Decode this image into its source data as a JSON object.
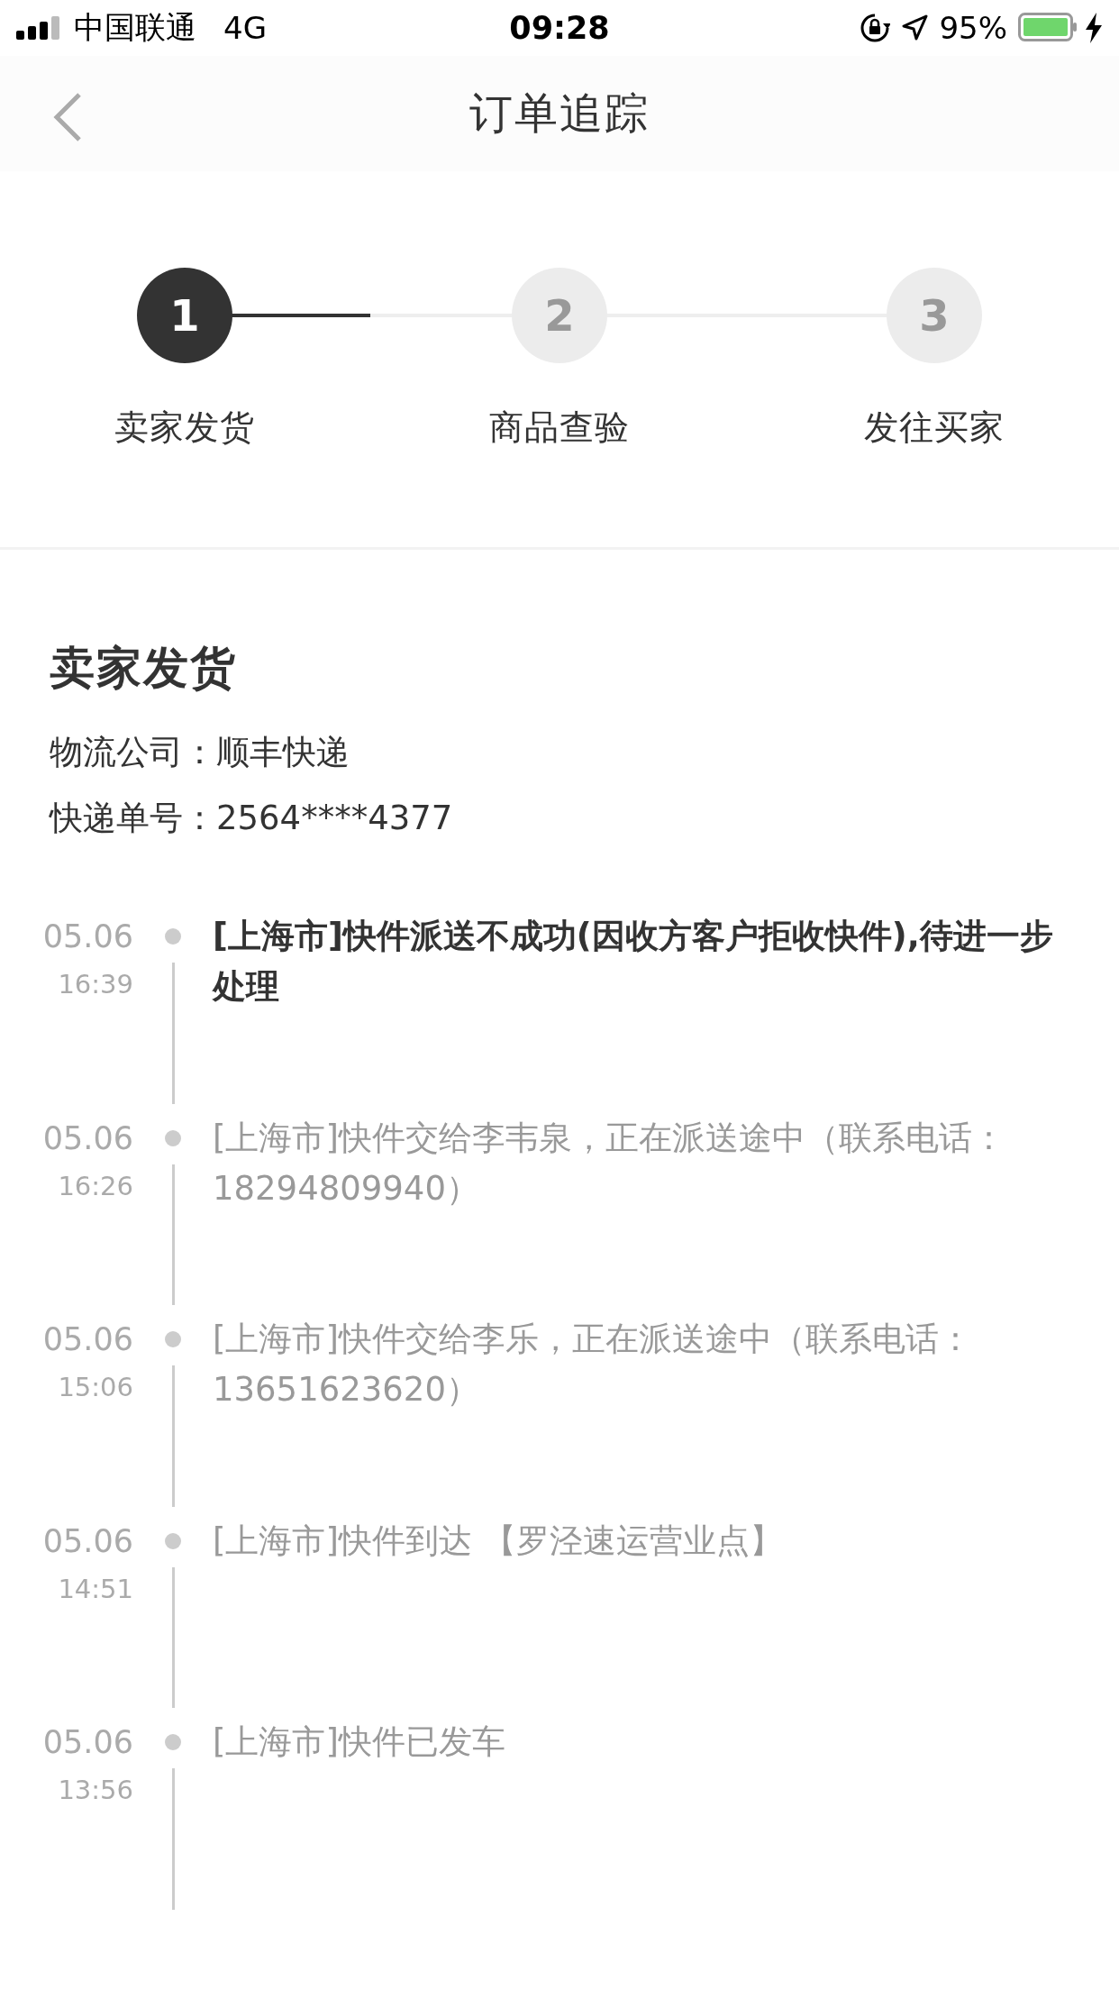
{
  "status_bar": {
    "carrier": "中国联通",
    "network": "4G",
    "time": "09:28",
    "battery": "95%"
  },
  "nav": {
    "title": "订单追踪"
  },
  "steps": {
    "level": 0.25,
    "items": [
      {
        "number": "1",
        "label": "卖家发货",
        "selected": true
      },
      {
        "number": "2",
        "label": "商品查验",
        "selected": false
      },
      {
        "number": "3",
        "label": "发往买家",
        "selected": false
      }
    ]
  },
  "shipment": {
    "heading": "卖家发货",
    "company_label": "物流公司：",
    "company": "顺丰快递",
    "tracking_label": "快递单号：",
    "tracking": "2564****4377"
  },
  "events": [
    {
      "date": "05.06",
      "time": "16:39",
      "text": "[上海市]快件派送不成功(因收方客户拒收快件),待进一步处理",
      "current": true
    },
    {
      "date": "05.06",
      "time": "16:26",
      "text": "[上海市]快件交给李韦泉，正在派送途中（联系电话：18294809940）",
      "current": false
    },
    {
      "date": "05.06",
      "time": "15:06",
      "text": "[上海市]快件交给李乐，正在派送途中（联系电话：13651623620）",
      "current": false
    },
    {
      "date": "05.06",
      "time": "14:51",
      "text": "[上海市]快件到达 【罗泾速运营业点】",
      "current": false
    },
    {
      "date": "05.06",
      "time": "13:56",
      "text": "[上海市]快件已发车",
      "current": false
    }
  ]
}
